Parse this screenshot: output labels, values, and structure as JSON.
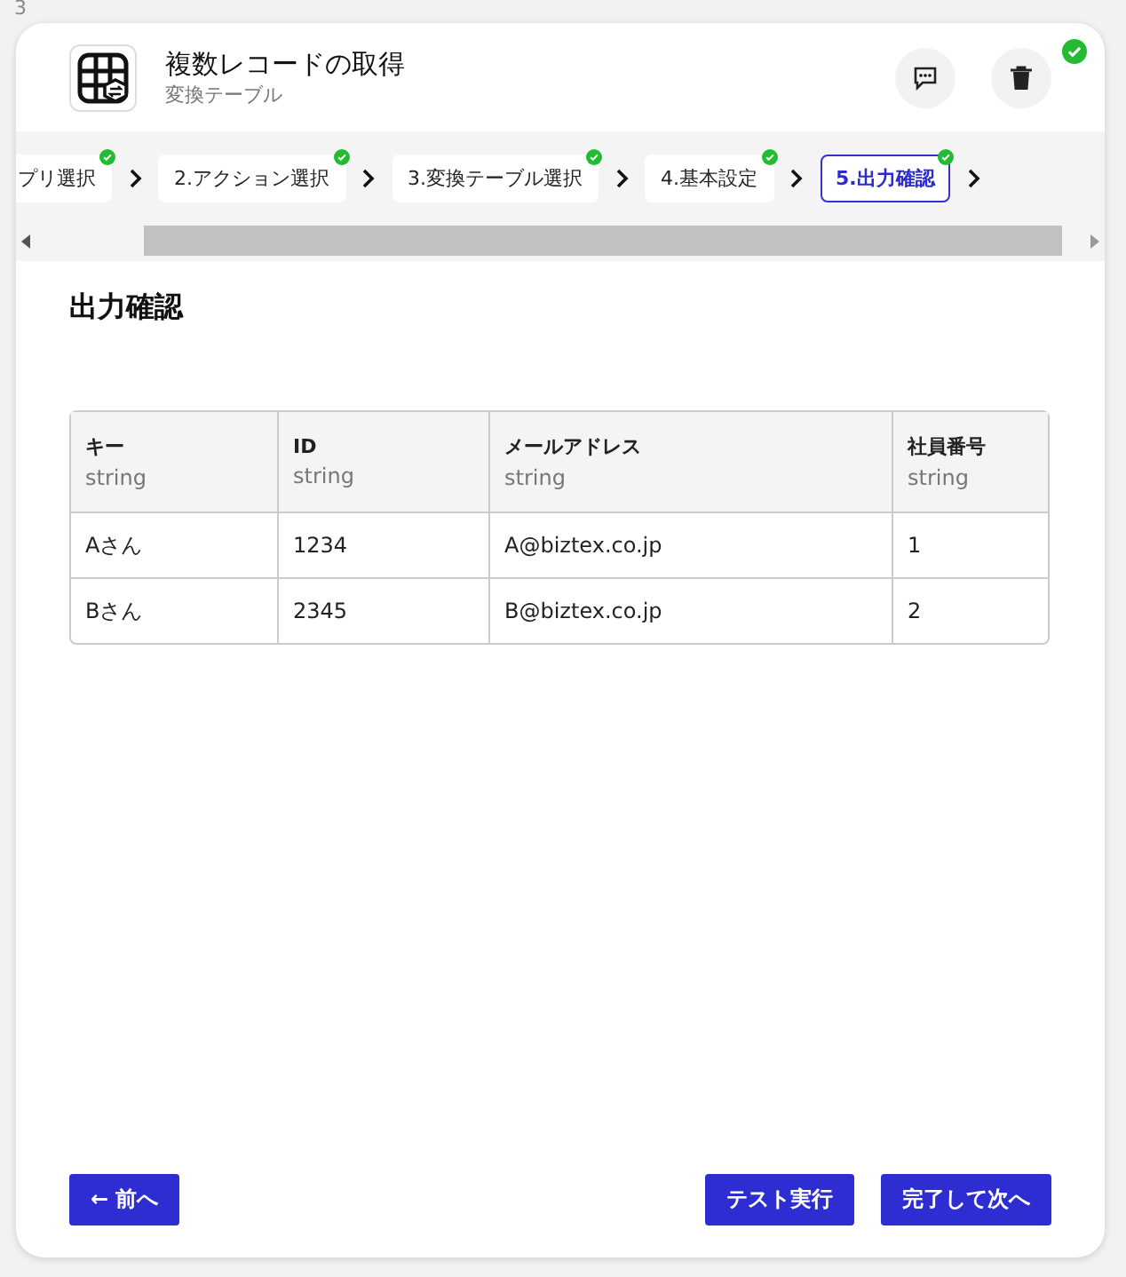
{
  "page_number": "3",
  "header": {
    "title": "複数レコードの取得",
    "subtitle": "変換テーブル",
    "completed": true
  },
  "steps": [
    {
      "label": "プリ選択",
      "done": true,
      "selected": false
    },
    {
      "label": "2.アクション選択",
      "done": true,
      "selected": false
    },
    {
      "label": "3.変換テーブル選択",
      "done": true,
      "selected": false
    },
    {
      "label": "4.基本設定",
      "done": true,
      "selected": false
    },
    {
      "label": "5.出力確認",
      "done": true,
      "selected": true
    }
  ],
  "section_title": "出力確認",
  "table": {
    "columns": [
      {
        "name": "キー",
        "type": "string"
      },
      {
        "name": "ID",
        "type": "string"
      },
      {
        "name": "メールアドレス",
        "type": "string"
      },
      {
        "name": "社員番号",
        "type": "string"
      }
    ],
    "rows": [
      [
        "Aさん",
        "1234",
        "A@biztex.co.jp",
        "1"
      ],
      [
        "Bさん",
        "2345",
        "B@biztex.co.jp",
        "2"
      ]
    ]
  },
  "buttons": {
    "back": "← 前へ",
    "test": "テスト実行",
    "next": "完了して次へ"
  }
}
